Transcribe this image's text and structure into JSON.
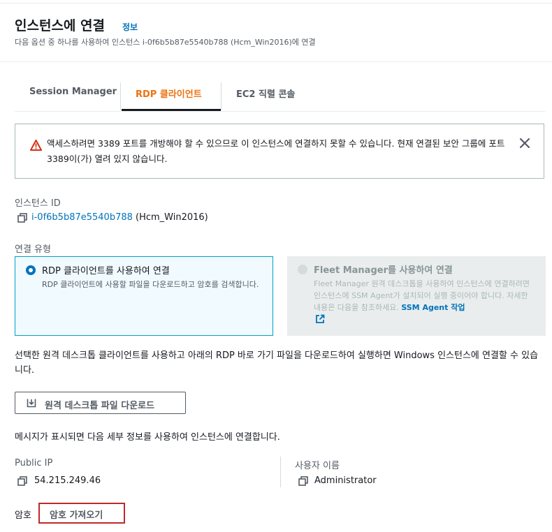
{
  "header": {
    "title": "인스턴스에 연결",
    "info_link": "정보",
    "subtitle": "다음 옵션 중 하나를 사용하여 인스턴스 i-0f6b5b87e5540b788 (Hcm_Win2016)에 연결"
  },
  "tabs": [
    {
      "label": "Session Manager",
      "active": false
    },
    {
      "label": "RDP 클라이언트",
      "active": true
    },
    {
      "label": "EC2 직렬 콘솔",
      "active": false
    }
  ],
  "alert": {
    "message": "액세스하려면 3389 포트를 개방해야 할 수 있으므로 이 인스턴스에 연결하지 못할 수 있습니다. 현재 연결된 보안 그룹에 포트 3389이(가) 열려 있지 않습니다."
  },
  "instance": {
    "label": "인스턴스 ID",
    "id": "i-0f6b5b87e5540b788",
    "name": "(Hcm_Win2016)"
  },
  "connection_type": {
    "label": "연결 유형",
    "rdp": {
      "title": "RDP 클라이언트를 사용하여 연결",
      "description": "RDP 클라이언트에 사용할 파일을 다운로드하고 암호를 검색합니다."
    },
    "fleet": {
      "title": "Fleet Manager를 사용하여 연결",
      "description": "Fleet Manager 원격 데스크톱을 사용하여 인스턴스에 연결하려면 인스턴스에 SSM Agent가 설치되어 실행 중이어야 합니다. 자세한 내용은 다음을 참조하세요.",
      "link": "SSM Agent 작업"
    }
  },
  "description": "선택한 원격 데스크톱 클라이언트를 사용하고 아래의 RDP 바로 가기 파일을 다운로드하여 실행하면 Windows 인스턴스에 연결할 수 있습니다.",
  "download_button": "원격 데스크톱 파일 다운로드",
  "detail_text": "메시지가 표시되면 다음 세부 정보를 사용하여 인스턴스에 연결합니다.",
  "public_ip": {
    "label": "Public IP",
    "value": "54.215.249.46"
  },
  "username": {
    "label": "사용자 이름",
    "value": "Administrator"
  },
  "password": {
    "label": "암호",
    "button": "암호 가져오기"
  },
  "colors": {
    "accent": "#ec7211",
    "link": "#0073bb",
    "warning": "#d13212",
    "selected_border": "#00a1c9"
  }
}
